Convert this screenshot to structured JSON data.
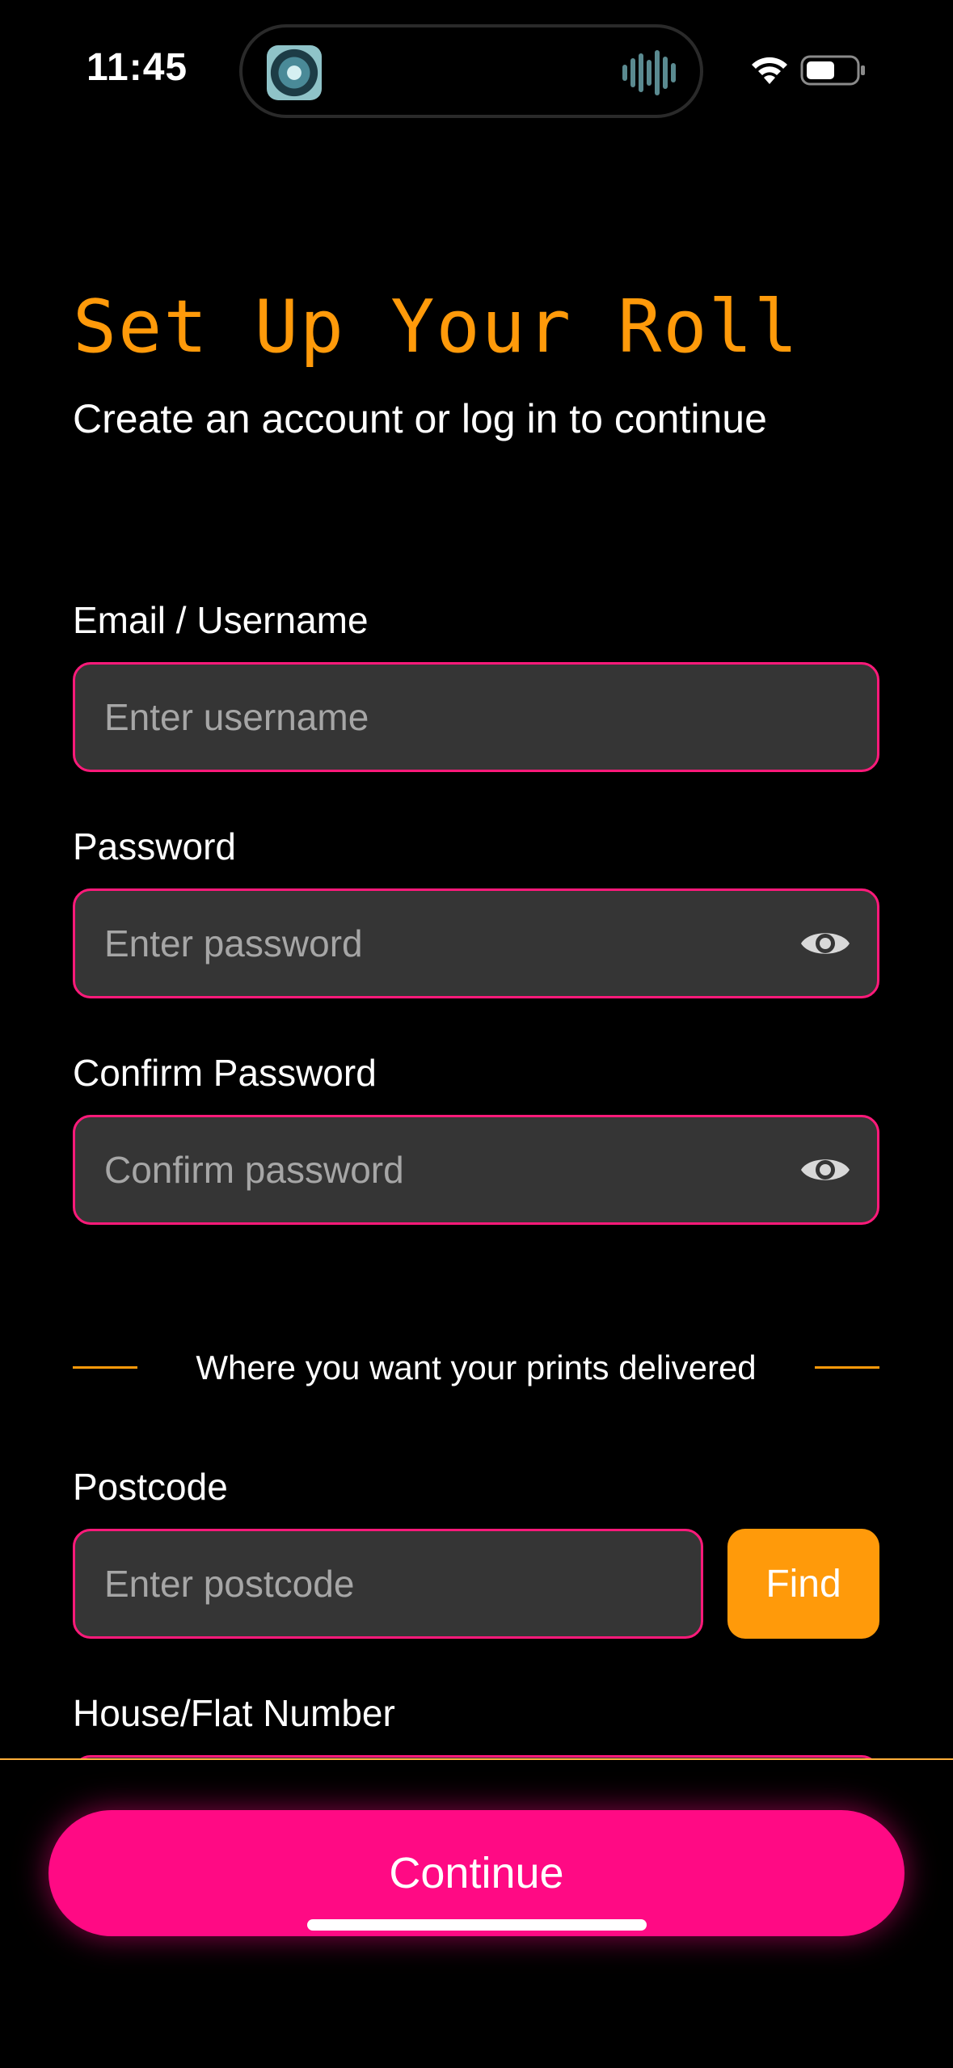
{
  "status_bar": {
    "time": "11:45",
    "island_app_icon": "app-thumbnail-icon",
    "island_activity_icon": "audio-waveform-icon",
    "wifi_icon": "wifi-icon",
    "battery_icon": "battery-icon"
  },
  "header": {
    "title": "Set Up Your Roll",
    "subtitle": "Create an account or log in to continue"
  },
  "form": {
    "email": {
      "label": "Email / Username",
      "placeholder": "Enter username",
      "value": ""
    },
    "password": {
      "label": "Password",
      "placeholder": "Enter password",
      "value": "",
      "toggle_icon": "eye-icon"
    },
    "confirm_password": {
      "label": "Confirm Password",
      "placeholder": "Confirm password",
      "value": "",
      "toggle_icon": "eye-icon"
    },
    "delivery_divider": "Where you want your prints delivered",
    "postcode": {
      "label": "Postcode",
      "placeholder": "Enter postcode",
      "value": "",
      "find_label": "Find"
    },
    "house_number": {
      "label": "House/Flat Number"
    }
  },
  "footer": {
    "continue_label": "Continue"
  },
  "colors": {
    "accent_orange": "#ff9a0a",
    "accent_pink": "#ff0a84",
    "field_border": "#ff1a7a",
    "field_bg": "#353535",
    "background": "#000000"
  }
}
